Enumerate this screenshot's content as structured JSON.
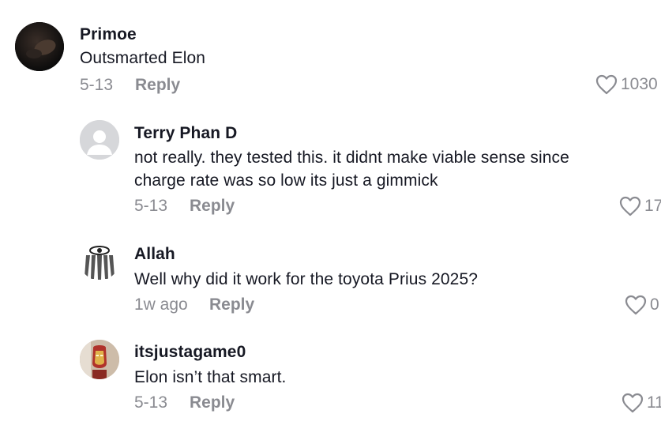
{
  "comments": [
    {
      "name": "Primoe",
      "text": "Outsmarted Elon",
      "date": "5-13",
      "reply_label": "Reply",
      "likes": "1030",
      "avatar": "dark-portrait-avatar"
    },
    {
      "name": "Terry Phan D",
      "text": "not really. they tested this. it didnt make viable sense since\ncharge rate was so low its just a gimmick",
      "date": "5-13",
      "reply_label": "Reply",
      "likes": "17",
      "avatar": "default-gray-avatar"
    },
    {
      "name": "Allah",
      "text": "Well why did it work for the toyota Prius 2025?",
      "date": "1w ago",
      "reply_label": "Reply",
      "likes": "0",
      "avatar": "eye-emblem-avatar"
    },
    {
      "name": "itsjustagame0",
      "text": "Elon isn’t that smart.",
      "date": "5-13",
      "reply_label": "Reply",
      "likes": "11",
      "avatar": "iron-man-avatar"
    }
  ],
  "colors": {
    "text": "#161823",
    "muted": "#8a8b91",
    "heart": "#8a8b91"
  },
  "icons": {
    "like": "heart-outline-icon"
  }
}
